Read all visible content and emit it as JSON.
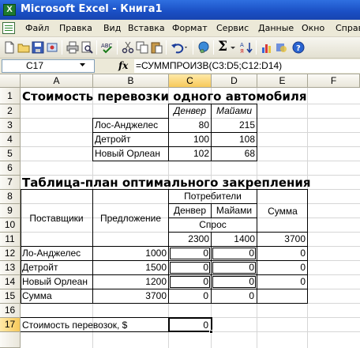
{
  "window": {
    "title": "Microsoft Excel - Книга1",
    "app_icon_letter": "X"
  },
  "menu": [
    "Файл",
    "Правка",
    "Вид",
    "Вставка",
    "Формат",
    "Сервис",
    "Данные",
    "Окно",
    "Справка"
  ],
  "toolbar": {
    "buttons": [
      "new-icon",
      "open-icon",
      "save-icon",
      "permission-icon",
      "print-icon",
      "print-preview-icon",
      "spelling-icon",
      "cut-icon",
      "copy-icon",
      "paste-icon",
      "undo-icon",
      "hyperlink-icon",
      "autosum-icon",
      "sort-ascending-icon",
      "chart-wizard-icon",
      "help-icon"
    ],
    "autosum_symbol": "Σ"
  },
  "formula_bar": {
    "name_box": "C17",
    "fx_label": "fx",
    "formula": "=СУММПРОИЗВ(C3:D5;C12:D14)"
  },
  "columns": [
    "A",
    "B",
    "C",
    "D",
    "E",
    "F"
  ],
  "active_column": "C",
  "rows": [
    "1",
    "2",
    "3",
    "4",
    "5",
    "6",
    "7",
    "8",
    "9",
    "10",
    "11",
    "12",
    "13",
    "14",
    "15",
    "16",
    "17"
  ],
  "active_row": "17",
  "sheet": {
    "title1": "Стоимость перевозки одного автомобиля",
    "cost_table": {
      "headers": [
        "Денвер",
        "Майами"
      ],
      "rows": [
        {
          "label": "Лос-Анджелес",
          "values": [
            "80",
            "215"
          ]
        },
        {
          "label": "Детройт",
          "values": [
            "100",
            "108"
          ]
        },
        {
          "label": "Новый Орлеан",
          "values": [
            "102",
            "68"
          ]
        }
      ]
    },
    "title2": "Таблица-план оптимального закрепления",
    "plan_table": {
      "col_suppliers": "Поставщики",
      "col_supply": "Предложение",
      "consumers_label": "Потребители",
      "consumers": [
        "Денвер",
        "Майами"
      ],
      "sum_label": "Сумма",
      "demand_label": "Спрос",
      "demand": [
        "2300",
        "1400"
      ],
      "demand_total": "3700",
      "rows": [
        {
          "label": "Ло-Анджелес",
          "supply": "1000",
          "values": [
            "0",
            "0"
          ],
          "sum": "0"
        },
        {
          "label": "Детройт",
          "supply": "1500",
          "values": [
            "0",
            "0"
          ],
          "sum": "0"
        },
        {
          "label": "Новый Орлеан",
          "supply": "1200",
          "values": [
            "0",
            "0"
          ],
          "sum": "0"
        }
      ],
      "total_row": {
        "label": "Сумма",
        "supply": "3700",
        "values": [
          "0",
          "0"
        ]
      }
    },
    "cost_label": "Стоимость перевозок, $",
    "cost_value": "0"
  }
}
